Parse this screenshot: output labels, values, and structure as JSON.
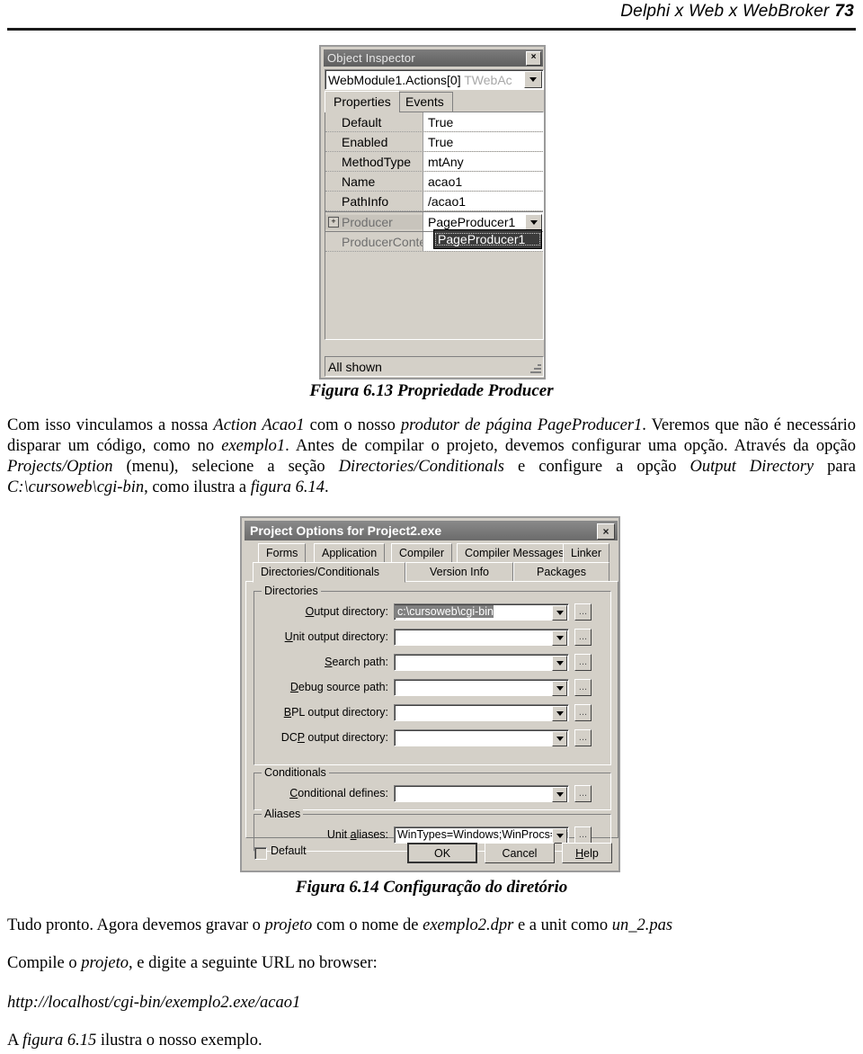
{
  "page_header": {
    "title": "Delphi x Web x WebBroker",
    "page_number": "73"
  },
  "object_inspector": {
    "window_title": "Object Inspector",
    "close_label": "×",
    "selector": {
      "object": "WebModule1.Actions[0]",
      "class": "TWebAc"
    },
    "tabs": [
      {
        "label": "Properties",
        "active": true
      },
      {
        "label": "Events",
        "active": false
      }
    ],
    "properties": [
      {
        "name": "Default",
        "value": "True"
      },
      {
        "name": "Enabled",
        "value": "True"
      },
      {
        "name": "MethodType",
        "value": "mtAny"
      },
      {
        "name": "Name",
        "value": "acao1"
      },
      {
        "name": "PathInfo",
        "value": "/acao1"
      },
      {
        "name": "Producer",
        "value": "PageProducer1",
        "expander": "+",
        "selected": true
      },
      {
        "name": "ProducerConte",
        "value": ""
      }
    ],
    "dropdown_open": {
      "highlighted_item": "PageProducer1"
    },
    "status": "All shown"
  },
  "figure_613_caption": "Figura 6.13 Propriedade Producer",
  "paragraph_1": {
    "segments": [
      {
        "text": "Com isso vinculamos a nossa ",
        "italic": false
      },
      {
        "text": "Action Acao1",
        "italic": true
      },
      {
        "text": " com o nosso ",
        "italic": false
      },
      {
        "text": "produtor de página PageProducer1",
        "italic": true
      },
      {
        "text": ". Veremos que não é necessário disparar um código, como no ",
        "italic": false
      },
      {
        "text": "exemplo1",
        "italic": true
      },
      {
        "text": ". Antes de compilar o projeto, devemos configurar uma opção. Através da opção ",
        "italic": false
      },
      {
        "text": "Projects/Option",
        "italic": true
      },
      {
        "text": " (menu), selecione a seção ",
        "italic": false
      },
      {
        "text": "Directories/Conditionals",
        "italic": true
      },
      {
        "text": " e configure a opção ",
        "italic": false
      },
      {
        "text": "Output Directory",
        "italic": true
      },
      {
        "text": " para ",
        "italic": false
      },
      {
        "text": "C:\\cursoweb\\cgi-bin",
        "italic": true
      },
      {
        "text": ", como ilustra a ",
        "italic": false
      },
      {
        "text": "figura 6.14",
        "italic": true
      },
      {
        "text": ".",
        "italic": false
      }
    ]
  },
  "project_options": {
    "window_title": "Project Options for Project2.exe",
    "close_label": "×",
    "tabs_row1": [
      {
        "label": "Forms",
        "active": false
      },
      {
        "label": "Application",
        "active": false
      },
      {
        "label": "Compiler",
        "active": false
      },
      {
        "label": "Compiler Messages",
        "active": false
      },
      {
        "label": "Linker",
        "active": false
      }
    ],
    "tabs_row2": [
      {
        "label": "Directories/Conditionals",
        "active": true
      },
      {
        "label": "Version Info",
        "active": false
      },
      {
        "label": "Packages",
        "active": false
      }
    ],
    "groups": {
      "directories": {
        "title": "Directories",
        "fields": [
          {
            "label": "Output directory:",
            "accel": "O",
            "value": "c:\\cursoweb\\cgi-bin",
            "selected": true
          },
          {
            "label": "Unit output directory:",
            "accel": "U",
            "value": "",
            "selected": false
          },
          {
            "label": "Search path:",
            "accel": "S",
            "value": "",
            "selected": false
          },
          {
            "label": "Debug source path:",
            "accel": "D",
            "value": "",
            "selected": false
          },
          {
            "label": "BPL output directory:",
            "accel": "B",
            "value": "",
            "selected": false
          },
          {
            "label": "DCP output directory:",
            "accel": "P",
            "value": "",
            "selected": false
          }
        ]
      },
      "conditionals": {
        "title": "Conditionals",
        "fields": [
          {
            "label": "Conditional defines:",
            "accel": "C",
            "value": "",
            "selected": false
          }
        ]
      },
      "aliases": {
        "title": "Aliases",
        "fields": [
          {
            "label": "Unit aliases:",
            "accel": "a",
            "value": "WinTypes=Windows;WinProcs=Windows;D",
            "selected": false
          }
        ]
      }
    },
    "footer": {
      "default_checkbox_label": "Default",
      "default_checked": false,
      "buttons": [
        {
          "label": "OK",
          "default": true
        },
        {
          "label": "Cancel",
          "default": false
        },
        {
          "label": "Help",
          "default": false
        }
      ]
    },
    "browse_button_label": "..."
  },
  "figure_614_caption": "Figura 6.14 Configuração do diretório",
  "paragraph_2": {
    "segments": [
      {
        "text": "Tudo pronto. Agora devemos gravar o ",
        "italic": false
      },
      {
        "text": "projeto",
        "italic": true
      },
      {
        "text": " com o nome de ",
        "italic": false
      },
      {
        "text": "exemplo2.dpr",
        "italic": true
      },
      {
        "text": " e a unit como ",
        "italic": false
      },
      {
        "text": "un_2.pas",
        "italic": true
      }
    ]
  },
  "paragraph_3": {
    "segments": [
      {
        "text": "Compile o ",
        "italic": false
      },
      {
        "text": "projeto",
        "italic": true
      },
      {
        "text": ", e digite a seguinte URL no browser:",
        "italic": false
      }
    ]
  },
  "url_line": "http://localhost/cgi-bin/exemplo2.exe/acao1",
  "paragraph_4": {
    "segments": [
      {
        "text": "A ",
        "italic": false
      },
      {
        "text": "figura 6.15",
        "italic": true
      },
      {
        "text": " ilustra o nosso exemplo.",
        "italic": false
      }
    ]
  }
}
